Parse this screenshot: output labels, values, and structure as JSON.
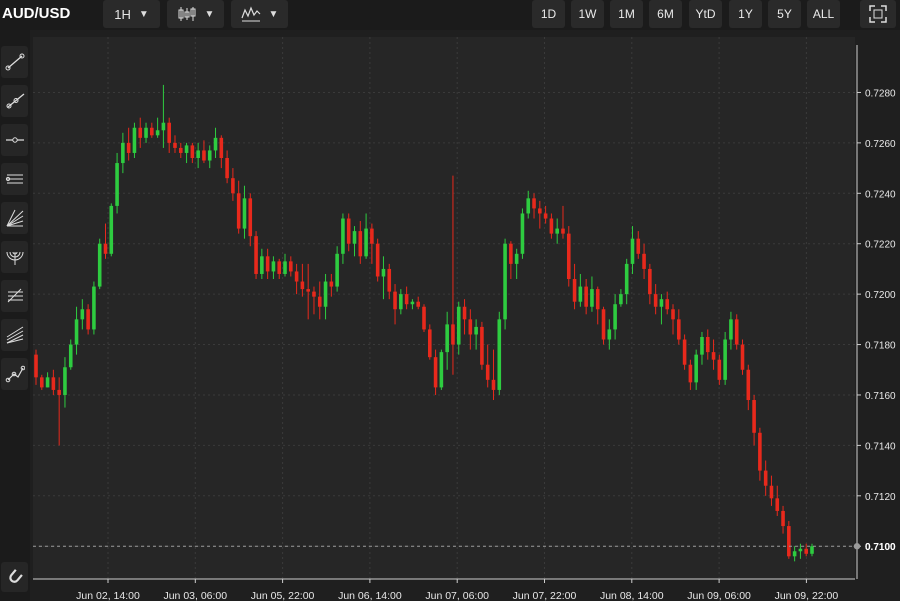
{
  "toolbar": {
    "symbol": "AUD/USD",
    "interval": "1H",
    "ranges": [
      "1D",
      "1W",
      "1M",
      "6M",
      "YtD",
      "1Y",
      "5Y",
      "ALL"
    ]
  },
  "tools": [
    "trend-line-icon",
    "ray-icon",
    "horizontal-line-icon",
    "parallel-channel-icon",
    "fan-icon",
    "fib-arc-icon",
    "fib-retracement-icon",
    "pitchfork-icon",
    "path-icon"
  ],
  "colors": {
    "up": "#2ecc40",
    "down": "#e8291c",
    "background": "#262626",
    "grid": "#3a3a3a"
  },
  "chart_data": {
    "type": "candlestick",
    "symbol": "AUD/USD",
    "interval": "1H",
    "y_ticks": [
      "0.7280",
      "0.7260",
      "0.7240",
      "0.7220",
      "0.7200",
      "0.7180",
      "0.7160",
      "0.7140",
      "0.7120",
      "0.7100"
    ],
    "ylim": [
      0.7087,
      0.7302
    ],
    "x_ticks": [
      "Jun 02, 14:00",
      "Jun 03, 06:00",
      "Jun 05, 22:00",
      "Jun 06, 14:00",
      "Jun 07, 06:00",
      "Jun 07, 22:00",
      "Jun 08, 14:00",
      "Jun 09, 06:00",
      "Jun 09, 22:00"
    ],
    "last_price": "0.7100",
    "grid": true,
    "candles": [
      [
        0.7176,
        0.7178,
        0.7164,
        0.7167
      ],
      [
        0.7167,
        0.7168,
        0.7162,
        0.7163
      ],
      [
        0.7163,
        0.7169,
        0.7163,
        0.7167
      ],
      [
        0.7167,
        0.717,
        0.716,
        0.7162
      ],
      [
        0.7162,
        0.7167,
        0.714,
        0.716
      ],
      [
        0.716,
        0.7175,
        0.7155,
        0.7171
      ],
      [
        0.7171,
        0.7182,
        0.717,
        0.718
      ],
      [
        0.718,
        0.7195,
        0.7176,
        0.719
      ],
      [
        0.719,
        0.7198,
        0.7186,
        0.7194
      ],
      [
        0.7194,
        0.7196,
        0.7184,
        0.7186
      ],
      [
        0.7186,
        0.7205,
        0.7184,
        0.7203
      ],
      [
        0.7203,
        0.7222,
        0.7202,
        0.722
      ],
      [
        0.722,
        0.7228,
        0.7214,
        0.7216
      ],
      [
        0.7216,
        0.7236,
        0.7215,
        0.7235
      ],
      [
        0.7235,
        0.7256,
        0.7232,
        0.7252
      ],
      [
        0.7252,
        0.7264,
        0.7248,
        0.726
      ],
      [
        0.726,
        0.7266,
        0.7253,
        0.7256
      ],
      [
        0.7256,
        0.7268,
        0.7254,
        0.7266
      ],
      [
        0.7266,
        0.727,
        0.7258,
        0.7262
      ],
      [
        0.7262,
        0.7268,
        0.726,
        0.7266
      ],
      [
        0.7266,
        0.7268,
        0.7262,
        0.7263
      ],
      [
        0.7263,
        0.727,
        0.7262,
        0.7265
      ],
      [
        0.7265,
        0.7283,
        0.7258,
        0.7268
      ],
      [
        0.7268,
        0.727,
        0.7256,
        0.726
      ],
      [
        0.726,
        0.7263,
        0.7256,
        0.7258
      ],
      [
        0.7258,
        0.726,
        0.7254,
        0.7256
      ],
      [
        0.7256,
        0.726,
        0.7252,
        0.7259
      ],
      [
        0.7259,
        0.726,
        0.7252,
        0.7254
      ],
      [
        0.7254,
        0.726,
        0.725,
        0.7257
      ],
      [
        0.7257,
        0.7261,
        0.7252,
        0.7253
      ],
      [
        0.7253,
        0.7259,
        0.725,
        0.7257
      ],
      [
        0.7257,
        0.7266,
        0.7254,
        0.7262
      ],
      [
        0.7262,
        0.7263,
        0.725,
        0.7254
      ],
      [
        0.7254,
        0.7257,
        0.7244,
        0.7246
      ],
      [
        0.7246,
        0.725,
        0.7237,
        0.724
      ],
      [
        0.724,
        0.7245,
        0.7224,
        0.7226
      ],
      [
        0.7226,
        0.7243,
        0.7222,
        0.7238
      ],
      [
        0.7238,
        0.724,
        0.7219,
        0.7223
      ],
      [
        0.7223,
        0.7225,
        0.7206,
        0.7208
      ],
      [
        0.7208,
        0.7218,
        0.7206,
        0.7215
      ],
      [
        0.7215,
        0.7218,
        0.7206,
        0.7209
      ],
      [
        0.7209,
        0.7215,
        0.7206,
        0.7213
      ],
      [
        0.7213,
        0.7214,
        0.7206,
        0.7208
      ],
      [
        0.7208,
        0.7216,
        0.7207,
        0.7213
      ],
      [
        0.7213,
        0.7215,
        0.7207,
        0.7209
      ],
      [
        0.7209,
        0.7212,
        0.72,
        0.7205
      ],
      [
        0.7205,
        0.7212,
        0.7199,
        0.7202
      ],
      [
        0.7202,
        0.7212,
        0.719,
        0.7201
      ],
      [
        0.7201,
        0.7203,
        0.7192,
        0.7199
      ],
      [
        0.7199,
        0.7205,
        0.719,
        0.7195
      ],
      [
        0.7195,
        0.7208,
        0.719,
        0.7205
      ],
      [
        0.7205,
        0.7208,
        0.7199,
        0.7203
      ],
      [
        0.7203,
        0.7219,
        0.7201,
        0.7216
      ],
      [
        0.7216,
        0.7232,
        0.7212,
        0.723
      ],
      [
        0.723,
        0.7232,
        0.7217,
        0.722
      ],
      [
        0.722,
        0.7227,
        0.7215,
        0.7225
      ],
      [
        0.7225,
        0.7229,
        0.7212,
        0.7215
      ],
      [
        0.7215,
        0.7232,
        0.7214,
        0.7226
      ],
      [
        0.7226,
        0.7228,
        0.7212,
        0.722
      ],
      [
        0.722,
        0.7222,
        0.7205,
        0.7207
      ],
      [
        0.7207,
        0.7215,
        0.7198,
        0.721
      ],
      [
        0.721,
        0.7212,
        0.7198,
        0.7201
      ],
      [
        0.7201,
        0.7204,
        0.7188,
        0.7194
      ],
      [
        0.7194,
        0.7202,
        0.7192,
        0.72
      ],
      [
        0.72,
        0.7203,
        0.7194,
        0.7196
      ],
      [
        0.7196,
        0.7198,
        0.7194,
        0.7197
      ],
      [
        0.7197,
        0.7199,
        0.7194,
        0.7195
      ],
      [
        0.7195,
        0.7196,
        0.7185,
        0.7186
      ],
      [
        0.7186,
        0.7188,
        0.7174,
        0.7175
      ],
      [
        0.7175,
        0.7178,
        0.716,
        0.7163
      ],
      [
        0.7163,
        0.7178,
        0.7162,
        0.7177
      ],
      [
        0.7177,
        0.7193,
        0.717,
        0.7188
      ],
      [
        0.7188,
        0.7247,
        0.7168,
        0.718
      ],
      [
        0.718,
        0.7197,
        0.7176,
        0.7195
      ],
      [
        0.7195,
        0.7198,
        0.7184,
        0.719
      ],
      [
        0.719,
        0.7194,
        0.7178,
        0.7184
      ],
      [
        0.7184,
        0.719,
        0.7178,
        0.7187
      ],
      [
        0.7187,
        0.7189,
        0.717,
        0.7172
      ],
      [
        0.7172,
        0.718,
        0.7163,
        0.7166
      ],
      [
        0.7166,
        0.7178,
        0.7158,
        0.7162
      ],
      [
        0.7162,
        0.7193,
        0.716,
        0.719
      ],
      [
        0.719,
        0.7222,
        0.7186,
        0.722
      ],
      [
        0.722,
        0.7221,
        0.7206,
        0.7212
      ],
      [
        0.7212,
        0.7218,
        0.7206,
        0.7216
      ],
      [
        0.7216,
        0.7234,
        0.7214,
        0.7232
      ],
      [
        0.7232,
        0.7241,
        0.723,
        0.7238
      ],
      [
        0.7238,
        0.724,
        0.723,
        0.7234
      ],
      [
        0.7234,
        0.7237,
        0.7226,
        0.7232
      ],
      [
        0.7232,
        0.7235,
        0.7228,
        0.723
      ],
      [
        0.723,
        0.7232,
        0.7222,
        0.7224
      ],
      [
        0.7224,
        0.723,
        0.722,
        0.7226
      ],
      [
        0.7226,
        0.7235,
        0.7222,
        0.7224
      ],
      [
        0.7224,
        0.7227,
        0.7203,
        0.7206
      ],
      [
        0.7206,
        0.7212,
        0.7194,
        0.7197
      ],
      [
        0.7197,
        0.7208,
        0.7195,
        0.7203
      ],
      [
        0.7203,
        0.7206,
        0.7192,
        0.7195
      ],
      [
        0.7195,
        0.7207,
        0.7193,
        0.7202
      ],
      [
        0.7202,
        0.7203,
        0.7188,
        0.7194
      ],
      [
        0.7194,
        0.7195,
        0.718,
        0.7182
      ],
      [
        0.7182,
        0.719,
        0.7178,
        0.7186
      ],
      [
        0.7186,
        0.72,
        0.7182,
        0.7196
      ],
      [
        0.7196,
        0.7202,
        0.7195,
        0.72
      ],
      [
        0.72,
        0.7214,
        0.7196,
        0.7212
      ],
      [
        0.7212,
        0.7227,
        0.7208,
        0.7222
      ],
      [
        0.7222,
        0.7225,
        0.7214,
        0.7216
      ],
      [
        0.7216,
        0.722,
        0.7206,
        0.721
      ],
      [
        0.721,
        0.7212,
        0.7196,
        0.72
      ],
      [
        0.72,
        0.7204,
        0.7192,
        0.7195
      ],
      [
        0.7195,
        0.72,
        0.7188,
        0.7198
      ],
      [
        0.7198,
        0.7201,
        0.7192,
        0.7194
      ],
      [
        0.7194,
        0.7196,
        0.7184,
        0.719
      ],
      [
        0.719,
        0.7194,
        0.718,
        0.7182
      ],
      [
        0.7182,
        0.7184,
        0.717,
        0.7172
      ],
      [
        0.7172,
        0.7174,
        0.7162,
        0.7165
      ],
      [
        0.7165,
        0.7178,
        0.7162,
        0.7176
      ],
      [
        0.7176,
        0.7185,
        0.7172,
        0.7183
      ],
      [
        0.7183,
        0.7186,
        0.7174,
        0.7177
      ],
      [
        0.7177,
        0.7182,
        0.717,
        0.7174
      ],
      [
        0.7174,
        0.7176,
        0.7164,
        0.7166
      ],
      [
        0.7166,
        0.7185,
        0.7164,
        0.7182
      ],
      [
        0.7182,
        0.7193,
        0.7178,
        0.719
      ],
      [
        0.719,
        0.7192,
        0.7178,
        0.718
      ],
      [
        0.718,
        0.7182,
        0.7168,
        0.717
      ],
      [
        0.717,
        0.7172,
        0.7154,
        0.7158
      ],
      [
        0.7158,
        0.716,
        0.714,
        0.7145
      ],
      [
        0.7145,
        0.7147,
        0.7126,
        0.713
      ],
      [
        0.713,
        0.7134,
        0.712,
        0.7124
      ],
      [
        0.7124,
        0.7128,
        0.7116,
        0.7119
      ],
      [
        0.7119,
        0.7124,
        0.7112,
        0.7114
      ],
      [
        0.7114,
        0.7116,
        0.7105,
        0.7108
      ],
      [
        0.7108,
        0.711,
        0.7095,
        0.7096
      ],
      [
        0.7096,
        0.71,
        0.7094,
        0.7098
      ],
      [
        0.7098,
        0.7101,
        0.7095,
        0.7099
      ],
      [
        0.7099,
        0.7101,
        0.7096,
        0.7097
      ],
      [
        0.7097,
        0.7101,
        0.7096,
        0.71
      ]
    ]
  }
}
